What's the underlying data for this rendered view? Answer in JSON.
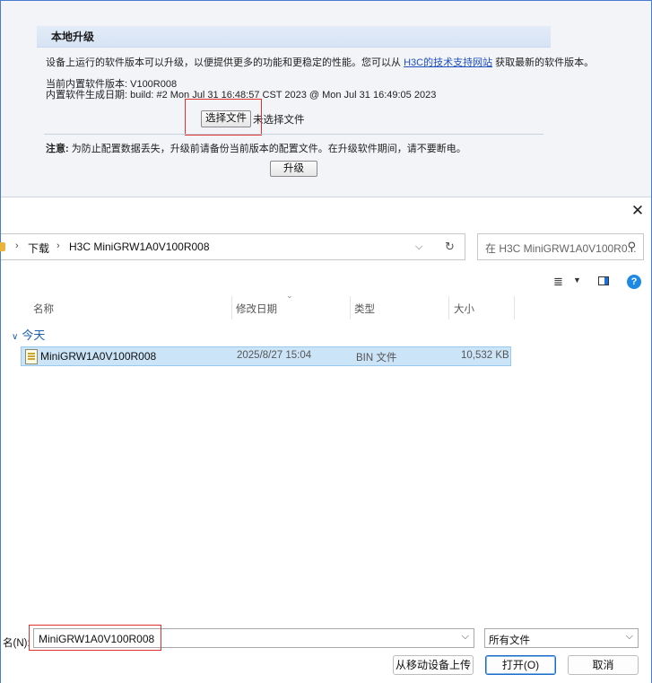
{
  "web": {
    "section_title": "本地升级",
    "intro_prefix": "设备上运行的软件版本可以升级，以便提供更多的功能和更稳定的性能。您可以从",
    "intro_link": "H3C的技术支持网站",
    "intro_suffix": "获取最新的软件版本。",
    "version_line": "当前内置软件版本: V100R008",
    "build_line": "内置软件生成日期:  build: #2 Mon Jul 31 16:48:57 CST 2023 @ Mon Jul 31 16:49:05 2023",
    "choose_file_button": "选择文件",
    "no_file_text": "未选择文件",
    "note_label": "注意:",
    "note_text": "为防止配置数据丢失，升级前请备份当前版本的配置文件。在升级软件期间，请不要断电。",
    "upgrade_button": "升级"
  },
  "dialog": {
    "close_icon": "close-icon",
    "breadcrumb": [
      "下载",
      "H3C MiniGRW1A0V100R008"
    ],
    "search_placeholder": "在 H3C MiniGRW1A0V100R0...",
    "columns": [
      "名称",
      "修改日期",
      "类型",
      "大小"
    ],
    "group_label": "今天",
    "files": [
      {
        "name": "MiniGRW1A0V100R008",
        "modified": "2025/8/27 15:04",
        "type": "BIN 文件",
        "size": "10,532 KB"
      }
    ],
    "filename_label": "名(N):",
    "filename_value": "MiniGRW1A0V100R008",
    "filetype_value": "所有文件",
    "upload_from_mobile_button": "从移动设备上传",
    "open_button": "打开(O)",
    "cancel_button": "取消"
  },
  "colors": {
    "accent": "#1e88e5",
    "selection": "#cce4f7",
    "highlight_box": "#e03030"
  }
}
